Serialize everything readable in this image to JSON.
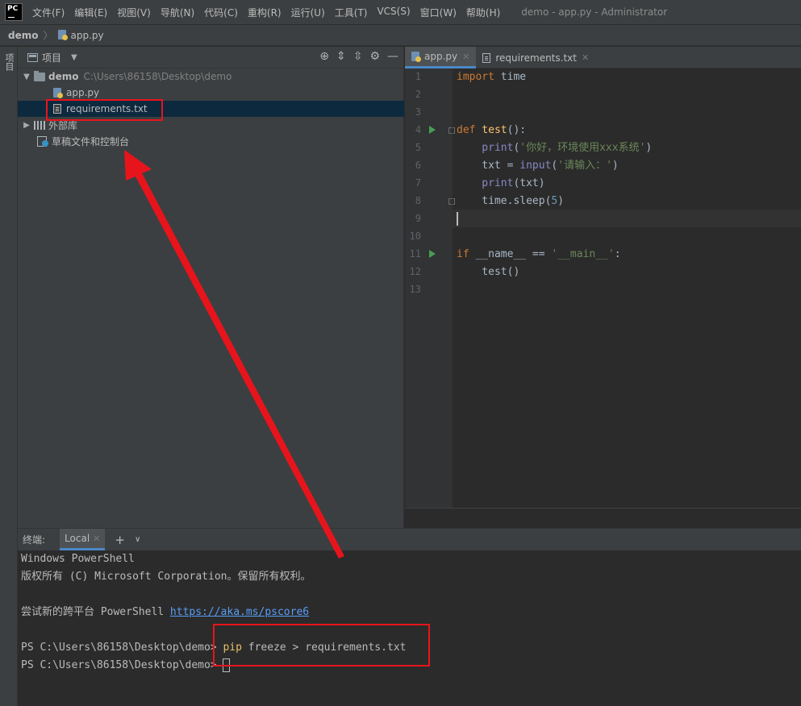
{
  "titlebar": {
    "logo": "PC",
    "menu": [
      "文件(F)",
      "编辑(E)",
      "视图(V)",
      "导航(N)",
      "代码(C)",
      "重构(R)",
      "运行(U)",
      "工具(T)",
      "VCS(S)",
      "窗口(W)",
      "帮助(H)"
    ],
    "window_title": "demo - app.py - Administrator"
  },
  "navbar": {
    "project": "demo",
    "file": "app.py"
  },
  "sidestrip": {
    "label": "项目"
  },
  "project_panel": {
    "title": "项目",
    "tree": {
      "root": "demo",
      "root_path": "C:\\Users\\86158\\Desktop\\demo",
      "files": [
        "app.py",
        "requirements.txt"
      ],
      "external": "外部库",
      "scratch": "草稿文件和控制台"
    }
  },
  "editor": {
    "tabs": [
      "app.py",
      "requirements.txt"
    ],
    "line_numbers": [
      "1",
      "2",
      "3",
      "4",
      "5",
      "6",
      "7",
      "8",
      "9",
      "10",
      "11",
      "12",
      "13"
    ],
    "code": {
      "l1a": "import",
      "l1b": " time",
      "l4a": "def",
      "l4b": " test",
      "l4c": "():",
      "l5a": "    print",
      "l5b": "(",
      "l5c": "'你好，环境使用xxx系统'",
      "l5d": ")",
      "l6a": "    txt = ",
      "l6b": "input",
      "l6c": "(",
      "l6d": "'请输入：'",
      "l6e": ")",
      "l7a": "    print",
      "l7b": "(txt)",
      "l8a": "    time.sleep(",
      "l8b": "5",
      "l8c": ")",
      "l11a": "if",
      "l11b": " __name__ == ",
      "l11c": "'__main__'",
      "l11d": ":",
      "l12a": "    test()"
    }
  },
  "terminal": {
    "label": "终端:",
    "tab": "Local",
    "lines": {
      "l1": "Windows PowerShell",
      "l2": "版权所有 (C) Microsoft Corporation。保留所有权利。",
      "l4a": "尝试新的跨平台 PowerShell ",
      "l4b": "https://aka.ms/pscore6",
      "l6a": "PS C:\\Users\\86158\\Desktop\\demo> ",
      "l6b": "pip",
      "l6c": " freeze > requirements.txt",
      "l7": "PS C:\\Users\\86158\\Desktop\\demo> "
    }
  },
  "colors": {
    "annotation": "#e8141c",
    "selection": "#0d293e",
    "accent": "#4a88c7"
  }
}
